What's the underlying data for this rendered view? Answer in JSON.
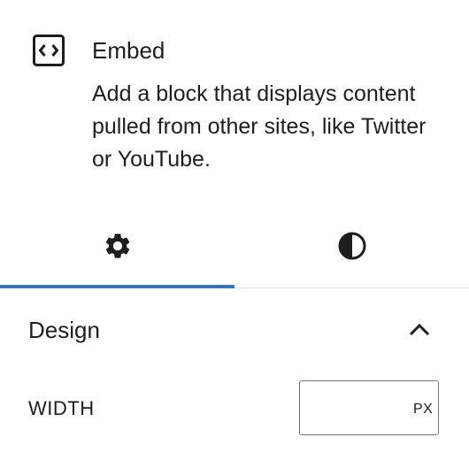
{
  "block": {
    "icon": "embed-icon",
    "title": "Embed",
    "description": "Add a block that displays content pulled from other sites, like Twitter or YouTube."
  },
  "tabs": [
    {
      "name": "settings",
      "icon": "gear-icon",
      "active": true
    },
    {
      "name": "styles",
      "icon": "half-circle-contrast-icon",
      "active": false
    }
  ],
  "panel": {
    "title": "Design",
    "expanded": true,
    "toggle_icon": "chevron-up-icon",
    "width": {
      "label": "WIDTH",
      "value": "",
      "unit": "PX"
    }
  },
  "colors": {
    "accent": "#3873b3",
    "text": "#1e1e1e",
    "border": "#757575",
    "divider": "#e0e0e0"
  }
}
